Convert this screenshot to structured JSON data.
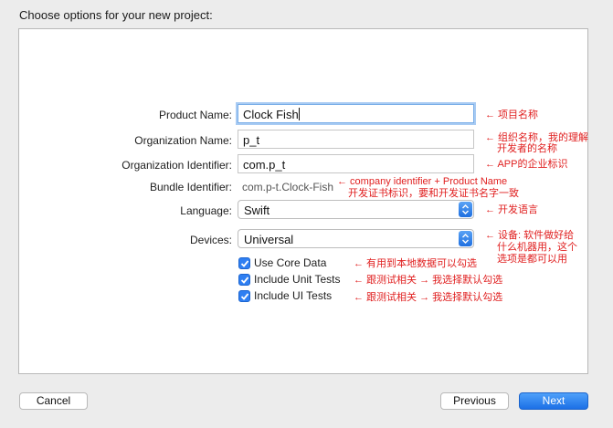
{
  "dialog": {
    "title": "Choose options for your new project:"
  },
  "form": {
    "product_name": {
      "label": "Product Name:",
      "value": "Clock Fish"
    },
    "org_name": {
      "label": "Organization Name:",
      "value": "p_t"
    },
    "org_identifier": {
      "label": "Organization Identifier:",
      "value": "com.p_t"
    },
    "bundle_identifier": {
      "label": "Bundle Identifier:",
      "value": "com.p-t.Clock-Fish"
    },
    "language": {
      "label": "Language:",
      "value": "Swift"
    },
    "devices": {
      "label": "Devices:",
      "value": "Universal"
    },
    "checkboxes": [
      {
        "label": "Use Core Data",
        "checked": true
      },
      {
        "label": "Include Unit Tests",
        "checked": true
      },
      {
        "label": "Include UI Tests",
        "checked": true
      }
    ]
  },
  "annotations": {
    "product_name": "← 项目名称",
    "org_name_line1": "← 组织名称，我的理解",
    "org_name_line2": "开发者的名称",
    "org_identifier": "← APP的企业标识",
    "bundle_line1": "← company identifier + Product Name",
    "bundle_line2": "开发证书标识，要和开发证书名字一致",
    "language": "← 开发语言",
    "devices_line1": "← 设备: 软件做好给",
    "devices_line2": "什么机器用，这个",
    "devices_line3": "选项是都可以用",
    "core_data": "← 有用到本地数据可以勾选",
    "unit_tests": "← 跟测试相关 → 我选择默认勾选",
    "ui_tests": "← 跟测试相关 → 我选择默认勾选",
    "color": "#e02020"
  },
  "buttons": {
    "cancel": "Cancel",
    "previous": "Previous",
    "next": "Next"
  }
}
